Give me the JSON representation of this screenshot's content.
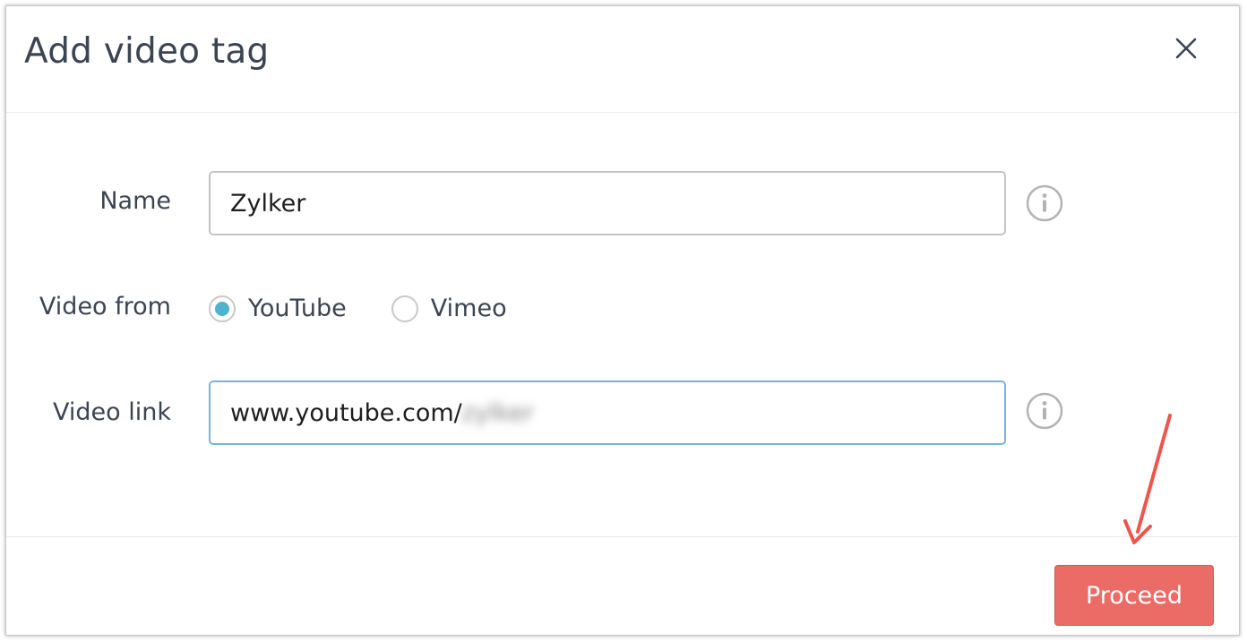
{
  "dialog": {
    "title": "Add video tag",
    "close_icon": "close-icon"
  },
  "form": {
    "name": {
      "label": "Name",
      "value": "Zylker",
      "info_icon": "info-icon"
    },
    "video_from": {
      "label": "Video from",
      "options": [
        {
          "label": "YouTube",
          "selected": true
        },
        {
          "label": "Vimeo",
          "selected": false
        }
      ],
      "accent_color": "#4fb3cf"
    },
    "video_link": {
      "label": "Video link",
      "value": "www.youtube.com/",
      "redacted_suffix": "zylker",
      "info_icon": "info-icon"
    }
  },
  "footer": {
    "proceed_label": "Proceed",
    "button_color": "#eb6b66"
  },
  "annotation": {
    "arrow_color": "#f0554c"
  }
}
